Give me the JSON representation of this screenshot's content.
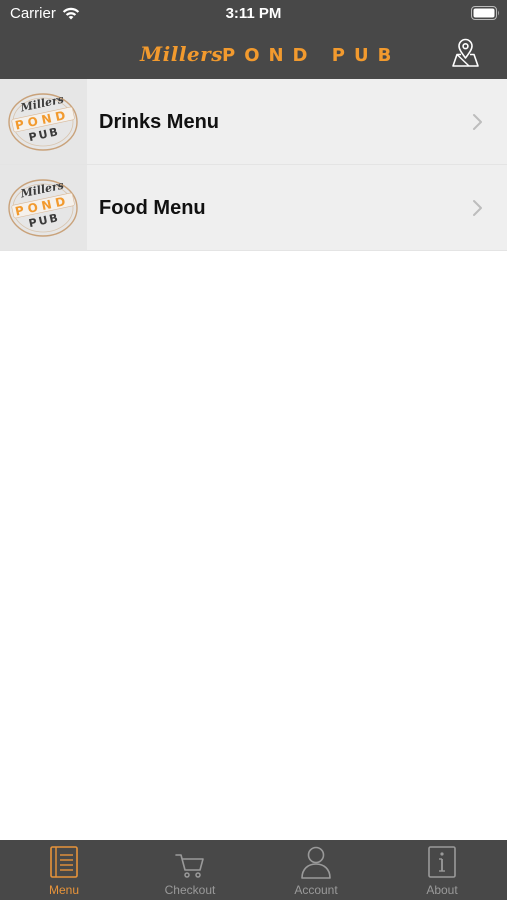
{
  "status_bar": {
    "carrier": "Carrier",
    "time": "3:11 PM"
  },
  "nav": {
    "brand_script": "Millers",
    "brand_caps": "POND PUB",
    "brand_color": "#f29a2e",
    "right_icon": "map-pin-icon"
  },
  "thumbnail_logo": {
    "script": "Millers",
    "caps_top": "POND",
    "caps_bottom": "PUB"
  },
  "menu_items": [
    {
      "label": "Drinks Menu"
    },
    {
      "label": "Food Menu"
    }
  ],
  "tabs": [
    {
      "label": "Menu",
      "icon": "menu-book-icon",
      "active": true
    },
    {
      "label": "Checkout",
      "icon": "cart-icon",
      "active": false
    },
    {
      "label": "Account",
      "icon": "person-icon",
      "active": false
    },
    {
      "label": "About",
      "icon": "info-icon",
      "active": false
    }
  ],
  "colors": {
    "header_bg": "#484848",
    "accent": "#e8943a",
    "inactive_tab": "#9a9a9a",
    "row_bg": "#efefef"
  }
}
